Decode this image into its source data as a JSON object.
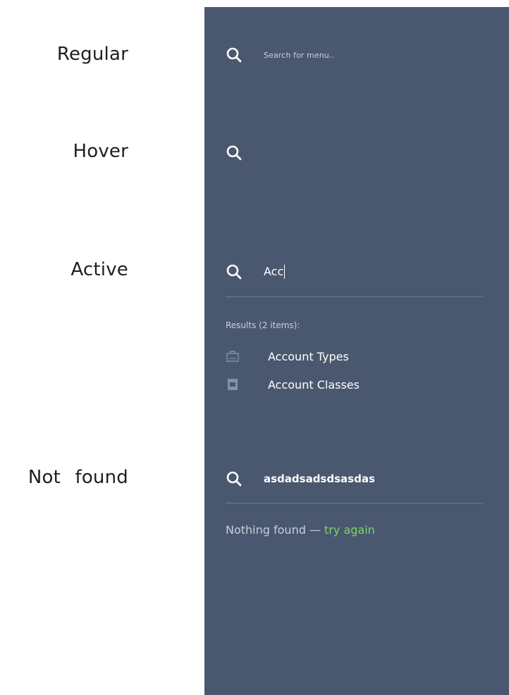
{
  "state_labels": {
    "regular": "Regular",
    "hover": "Hover",
    "active": "Active",
    "not_found": "Not found"
  },
  "colors": {
    "panel_bg": "#4a586f",
    "text_muted": "#c7cfdb",
    "text_primary": "#ffffff",
    "divider": "#6f7d92",
    "link_accent": "#7ed36a"
  },
  "regular": {
    "placeholder": "Search for menu..",
    "icon": "search-icon"
  },
  "hover": {
    "icon": "search-icon"
  },
  "active": {
    "query": "Acc",
    "results_heading": "Results (2 items):",
    "results": [
      {
        "label": "Account Types",
        "icon": "folder-icon"
      },
      {
        "label": "Account Classes",
        "icon": "document-icon"
      }
    ]
  },
  "not_found": {
    "query": "asdadsadsdsasdas",
    "message": "Nothing found — ",
    "link": "try again"
  }
}
